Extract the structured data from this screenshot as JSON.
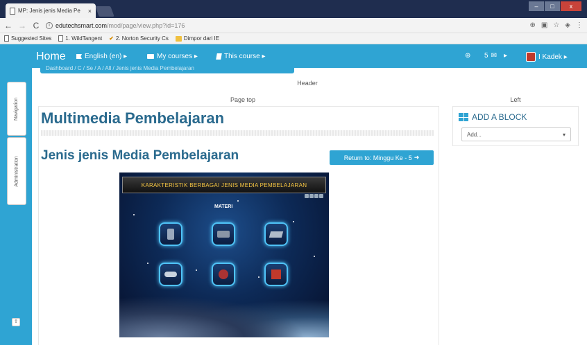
{
  "browser": {
    "tab_title": "MP: Jenis jenis Media Pe",
    "tab_close": "×",
    "url_domain": "edutechsmart.com",
    "url_path": "/mod/page/view.php?id=176",
    "bookmarks": [
      {
        "label": "Suggested Sites",
        "icon": "page-icon"
      },
      {
        "label": "1. WildTangent",
        "icon": "page-icon"
      },
      {
        "label": "2. Norton Security Cs",
        "icon": "check-icon"
      },
      {
        "label": "Dimpor dari IE",
        "icon": "folder-icon"
      }
    ]
  },
  "navbar": {
    "home": "Home",
    "language": "English (en) ▸",
    "my_courses": "My courses ▸",
    "this_course": "This course ▸",
    "messages_count": "5",
    "user": "I Kadek ▸",
    "breadcrumb": "Dashboard / C / Se / A / All / Jenis jenis Media Pembelajaran"
  },
  "dock": {
    "navigation": "Navigation",
    "administration": "Administration"
  },
  "regions": {
    "header": "Header",
    "page_top": "Page top",
    "left": "Left"
  },
  "main": {
    "course_title": "Multimedia Pembelajaran",
    "page_title": "Jenis jenis Media Pembelajaran",
    "return_button": "Return to: Minggu Ke - 5",
    "media_banner": "KARAKTERISTIK BERBAGAI JENIS MEDIA PEMBELAJARAN",
    "media_heading": "MATERI"
  },
  "block": {
    "title": "ADD A BLOCK",
    "select_value": "Add..."
  },
  "colors": {
    "accent": "#2fa4d3",
    "title": "#2a6a8e"
  }
}
